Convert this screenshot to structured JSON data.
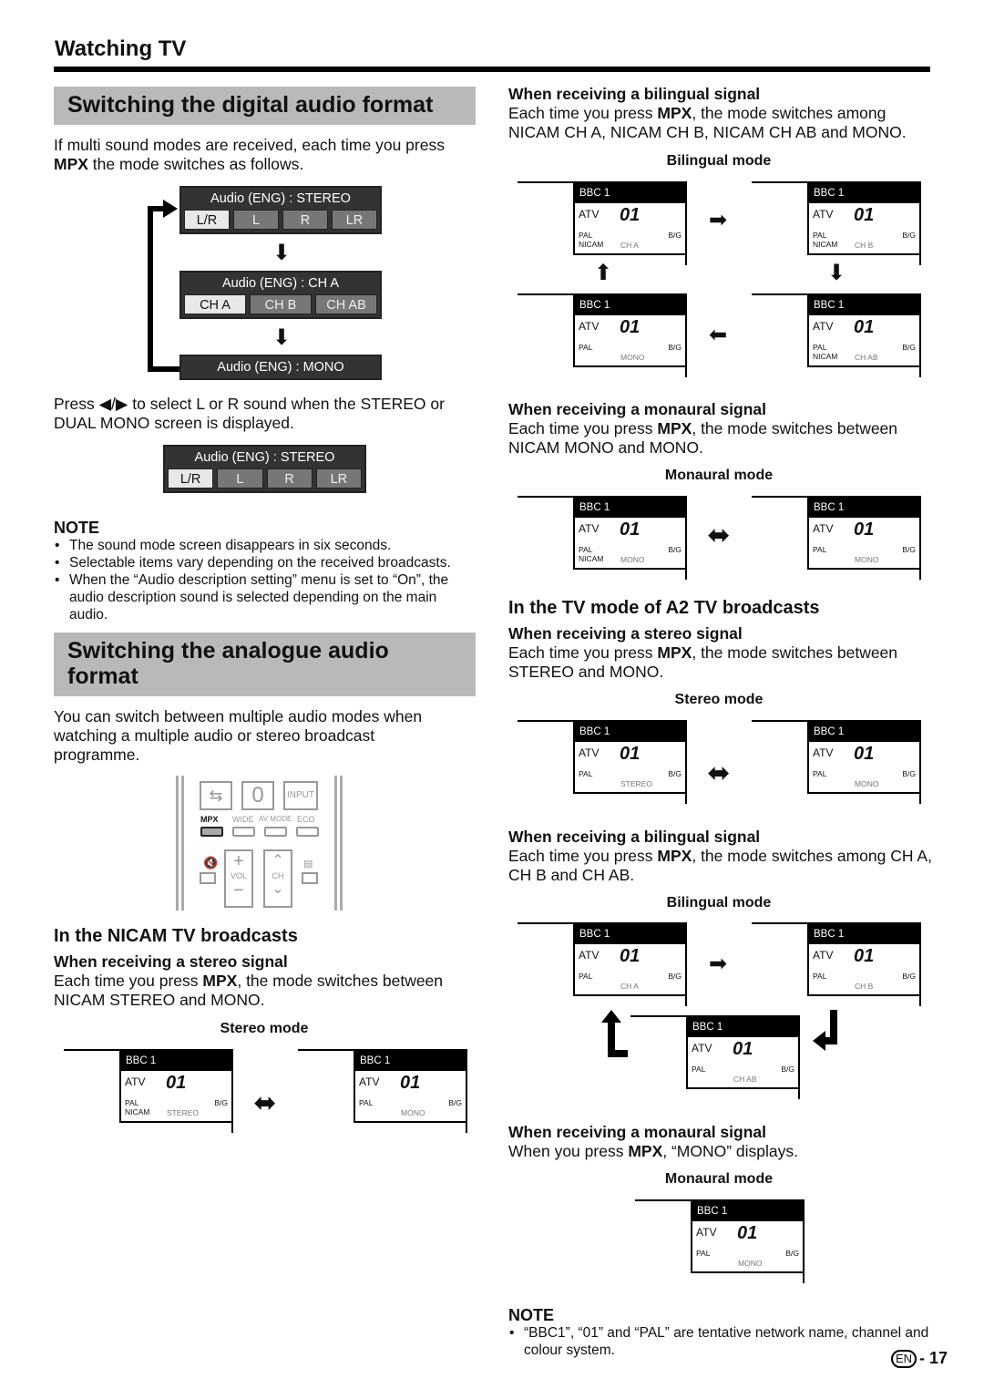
{
  "header": {
    "title": "Watching TV"
  },
  "digital": {
    "heading": "Switching the digital audio format",
    "intro_1": "If multi sound modes are received, each time you press",
    "intro_bold": "MPX",
    "intro_2": " the mode switches as follows.",
    "osd_stereo": {
      "label": "Audio (ENG) : STEREO",
      "options": [
        "L/R",
        "L",
        "R",
        "LR"
      ],
      "selected": "L/R"
    },
    "osd_cha": {
      "label": "Audio (ENG) : CH A",
      "options": [
        "CH A",
        "CH B",
        "CH AB"
      ],
      "selected": "CH A"
    },
    "osd_mono": {
      "label": "Audio (ENG) : MONO"
    },
    "press_text": "Press ◀/▶ to select L or R sound when the STEREO or DUAL MONO screen is displayed.",
    "osd_stereo2": {
      "label": "Audio (ENG) : STEREO",
      "options": [
        "L/R",
        "L",
        "R",
        "LR"
      ],
      "selected": "L/R"
    },
    "note_heading": "NOTE",
    "notes": [
      "The sound mode screen disappears in six seconds.",
      "Selectable items vary depending on the received broadcasts.",
      "When the “Audio description setting” menu is set to “On”, the audio description sound is selected depending on the main audio."
    ]
  },
  "analogue": {
    "heading": "Switching the analogue audio format",
    "intro": "You can switch between multiple audio modes when watching a multiple audio or stereo broadcast programme.",
    "remote": {
      "buttons_row1": [
        "swap-icon",
        "0",
        "INPUT"
      ],
      "labels_row2": [
        "MPX",
        "WIDE",
        "AV MODE",
        "ECO"
      ],
      "vol": "VOL",
      "ch": "CH",
      "highlight": "MPX"
    }
  },
  "nicam": {
    "heading": "In the NICAM TV broadcasts",
    "stereo": {
      "heading": "When receiving a stereo signal",
      "text_1": "Each time you press ",
      "bold": "MPX",
      "text_2": ", the mode switches between NICAM STEREO and MONO.",
      "caption": "Stereo mode"
    },
    "bilingual": {
      "heading": "When receiving a bilingual signal",
      "text_1": "Each time you press ",
      "bold": "MPX",
      "text_2": ", the mode switches among NICAM CH A, NICAM CH B, NICAM CH AB and MONO.",
      "caption": "Bilingual mode"
    },
    "monaural": {
      "heading": "When receiving a monaural signal",
      "text_1": "Each time you press ",
      "bold": "MPX",
      "text_2": ", the mode switches between NICAM MONO and MONO.",
      "caption": "Monaural mode"
    }
  },
  "a2": {
    "heading": "In the TV mode of A2 TV broadcasts",
    "stereo": {
      "heading": "When receiving a stereo signal",
      "text_1": "Each time you press ",
      "bold": "MPX",
      "text_2": ", the mode switches between STEREO and MONO.",
      "caption": "Stereo mode"
    },
    "bilingual": {
      "heading": "When receiving a bilingual signal",
      "text_1": "Each time you press ",
      "bold": "MPX",
      "text_2": ", the mode switches among CH A, CH B and CH AB.",
      "caption": "Bilingual mode"
    },
    "monaural": {
      "heading": "When receiving a monaural signal",
      "text_1": "When you press ",
      "bold": "MPX",
      "text_2": ", “MONO” displays.",
      "caption": "Monaural mode"
    }
  },
  "screen_common": {
    "channel": "BBC 1",
    "source": "ATV",
    "number": "01",
    "system": "PAL",
    "band": "B/G"
  },
  "screens": [
    {
      "nicam": "NICAM",
      "mode": "STEREO"
    },
    {
      "nicam": "",
      "mode": "MONO"
    },
    {
      "nicam": "NICAM",
      "mode": "CH A"
    },
    {
      "nicam": "NICAM",
      "mode": "CH B"
    },
    {
      "nicam": "",
      "mode": "MONO"
    },
    {
      "nicam": "NICAM",
      "mode": "CH AB"
    },
    {
      "nicam": "NICAM",
      "mode": "MONO"
    },
    {
      "nicam": "",
      "mode": "MONO"
    },
    {
      "nicam": "",
      "mode": "STEREO"
    },
    {
      "nicam": "",
      "mode": "MONO"
    },
    {
      "nicam": "",
      "mode": "CH A"
    },
    {
      "nicam": "",
      "mode": "CH B"
    },
    {
      "nicam": "",
      "mode": "CH AB"
    },
    {
      "nicam": "",
      "mode": "MONO"
    }
  ],
  "footer": {
    "note_heading": "NOTE",
    "note": "“BBC1”, “01” and “PAL” are tentative network name, channel and colour system.",
    "lang": "EN",
    "page": "- 17"
  }
}
